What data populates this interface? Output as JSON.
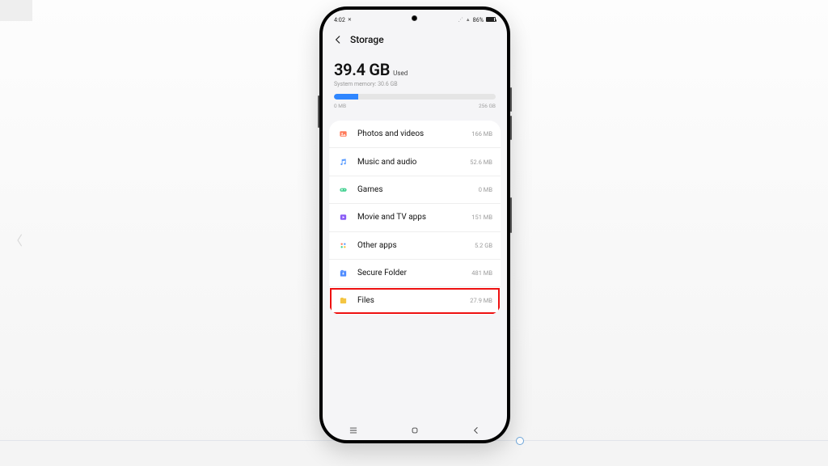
{
  "statusbar": {
    "time": "4:02",
    "mode_icon": "✕",
    "wifi_icon": "⋰",
    "signal_icon": "▮",
    "battery_pct": "86%"
  },
  "header": {
    "title": "Storage"
  },
  "storage": {
    "used_amount": "39.4 GB",
    "used_label": "Used",
    "system_memory": "System memory: 30.6 GB",
    "bar_min": "0 MB",
    "bar_max": "256 GB",
    "fill_pct": "15%"
  },
  "categories": [
    {
      "icon": "photos",
      "label": "Photos and videos",
      "size": "166 MB"
    },
    {
      "icon": "music",
      "label": "Music and audio",
      "size": "52.6 MB"
    },
    {
      "icon": "games",
      "label": "Games",
      "size": "0 MB"
    },
    {
      "icon": "movie",
      "label": "Movie and TV apps",
      "size": "151 MB"
    },
    {
      "icon": "other",
      "label": "Other apps",
      "size": "5.2 GB"
    },
    {
      "icon": "secure",
      "label": "Secure Folder",
      "size": "481 MB"
    },
    {
      "icon": "files",
      "label": "Files",
      "size": "27.9 MB",
      "highlight": true
    }
  ],
  "colors": {
    "accent": "#2f86ff",
    "highlight_border": "#e11"
  }
}
